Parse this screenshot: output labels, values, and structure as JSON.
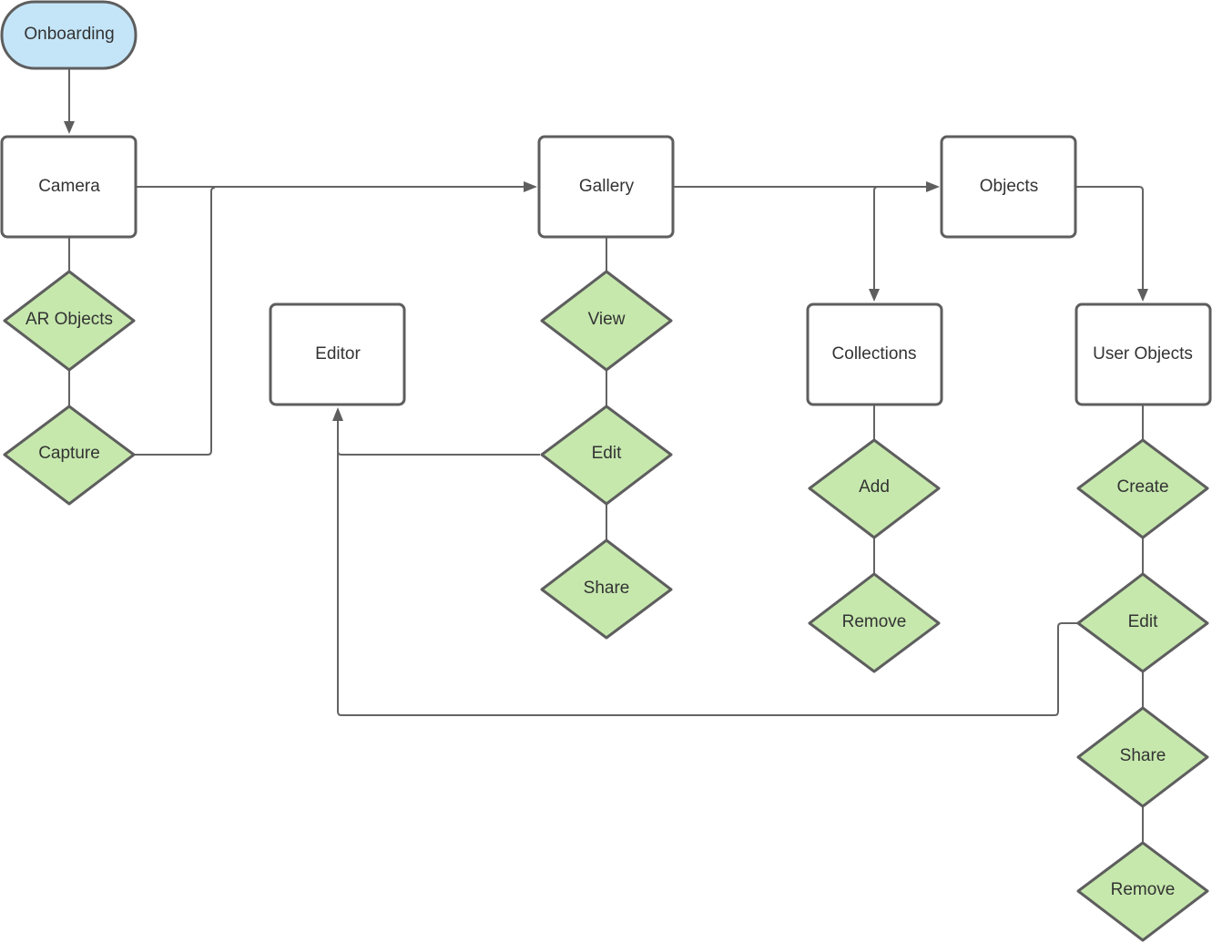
{
  "diagram": {
    "type": "flowchart",
    "colors": {
      "start_fill": "#c4e5f8",
      "process_fill": "#ffffff",
      "decision_fill": "#c6e8ad",
      "stroke": "#5e5e5e",
      "text": "#333333"
    },
    "nodes": [
      {
        "id": "onboarding",
        "label": "Onboarding",
        "shape": "terminal"
      },
      {
        "id": "camera",
        "label": "Camera",
        "shape": "process"
      },
      {
        "id": "ar-objects",
        "label": "AR Objects",
        "shape": "decision"
      },
      {
        "id": "capture",
        "label": "Capture",
        "shape": "decision"
      },
      {
        "id": "editor",
        "label": "Editor",
        "shape": "process"
      },
      {
        "id": "gallery",
        "label": "Gallery",
        "shape": "process"
      },
      {
        "id": "gallery-view",
        "label": "View",
        "shape": "decision"
      },
      {
        "id": "gallery-edit",
        "label": "Edit",
        "shape": "decision"
      },
      {
        "id": "gallery-share",
        "label": "Share",
        "shape": "decision"
      },
      {
        "id": "objects",
        "label": "Objects",
        "shape": "process"
      },
      {
        "id": "collections",
        "label": "Collections",
        "shape": "process"
      },
      {
        "id": "collections-add",
        "label": "Add",
        "shape": "decision"
      },
      {
        "id": "collections-remove",
        "label": "Remove",
        "shape": "decision"
      },
      {
        "id": "user-objects",
        "label": "User Objects",
        "shape": "process"
      },
      {
        "id": "user-objects-create",
        "label": "Create",
        "shape": "decision"
      },
      {
        "id": "user-objects-edit",
        "label": "Edit",
        "shape": "decision"
      },
      {
        "id": "user-objects-share",
        "label": "Share",
        "shape": "decision"
      },
      {
        "id": "user-objects-remove",
        "label": "Remove",
        "shape": "decision"
      }
    ],
    "edges": [
      {
        "from": "onboarding",
        "to": "camera",
        "arrow": true
      },
      {
        "from": "camera",
        "to": "gallery",
        "arrow": true
      },
      {
        "from": "capture",
        "to": "gallery",
        "arrow": true
      },
      {
        "from": "camera",
        "to": "ar-objects",
        "arrow": false
      },
      {
        "from": "ar-objects",
        "to": "capture",
        "arrow": false
      },
      {
        "from": "gallery",
        "to": "objects",
        "arrow": true
      },
      {
        "from": "gallery",
        "to": "collections",
        "arrow": true
      },
      {
        "from": "objects",
        "to": "user-objects",
        "arrow": true
      },
      {
        "from": "gallery",
        "to": "gallery-view",
        "arrow": false
      },
      {
        "from": "gallery-view",
        "to": "gallery-edit",
        "arrow": false
      },
      {
        "from": "gallery-edit",
        "to": "gallery-share",
        "arrow": false
      },
      {
        "from": "gallery-edit",
        "to": "editor",
        "arrow": true
      },
      {
        "from": "collections",
        "to": "collections-add",
        "arrow": false
      },
      {
        "from": "collections-add",
        "to": "collections-remove",
        "arrow": false
      },
      {
        "from": "user-objects",
        "to": "user-objects-create",
        "arrow": false
      },
      {
        "from": "user-objects-create",
        "to": "user-objects-edit",
        "arrow": false
      },
      {
        "from": "user-objects-edit",
        "to": "user-objects-share",
        "arrow": false
      },
      {
        "from": "user-objects-share",
        "to": "user-objects-remove",
        "arrow": false
      },
      {
        "from": "user-objects-edit",
        "to": "editor",
        "arrow": true
      }
    ]
  }
}
